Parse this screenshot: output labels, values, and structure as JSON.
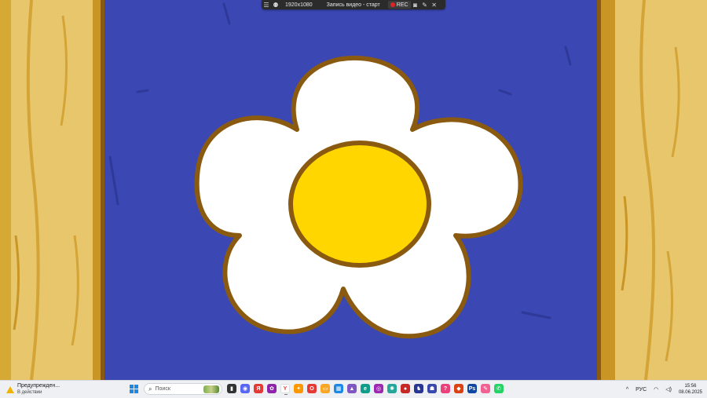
{
  "recorder": {
    "resolution": "1920x1080",
    "status": "Запись видео - старт",
    "rec_label": "REC",
    "icons": [
      "menu-icon",
      "user-icon",
      "camera-icon",
      "pen-icon",
      "close-icon"
    ]
  },
  "taskbar": {
    "notification_title": "Предупрежден...",
    "notification_sub": "В действии",
    "search_placeholder": "Поиск",
    "apps": [
      {
        "name": "task-view",
        "color": "#333333",
        "glyph": "▮"
      },
      {
        "name": "chat",
        "color": "#5865f2",
        "glyph": "◉"
      },
      {
        "name": "yandex",
        "color": "#e53935",
        "glyph": "Я"
      },
      {
        "name": "app-colorful",
        "color": "#8e24aa",
        "glyph": "✿"
      },
      {
        "name": "yandex-browser",
        "color": "#ffffff",
        "glyph": "Y"
      },
      {
        "name": "app-star",
        "color": "#ff9800",
        "glyph": "✦"
      },
      {
        "name": "opera",
        "color": "#e53935",
        "glyph": "O"
      },
      {
        "name": "files",
        "color": "#f9a825",
        "glyph": "▭"
      },
      {
        "name": "store",
        "color": "#1e88e5",
        "glyph": "▦"
      },
      {
        "name": "app-purple",
        "color": "#7e57c2",
        "glyph": "▲"
      },
      {
        "name": "edge",
        "color": "#0f9d8a",
        "glyph": "e"
      },
      {
        "name": "app-violet",
        "color": "#9c27b0",
        "glyph": "◎"
      },
      {
        "name": "app-teal",
        "color": "#26a69a",
        "glyph": "✺"
      },
      {
        "name": "app-red",
        "color": "#c62828",
        "glyph": "●"
      },
      {
        "name": "game-1",
        "color": "#283593",
        "glyph": "♞"
      },
      {
        "name": "game-2",
        "color": "#3949ab",
        "glyph": "☗"
      },
      {
        "name": "app-pink",
        "color": "#ec407a",
        "glyph": "?"
      },
      {
        "name": "office",
        "color": "#d84315",
        "glyph": "◆"
      },
      {
        "name": "photoshop",
        "color": "#0d47a1",
        "glyph": "Ps"
      },
      {
        "name": "app-gradient",
        "color": "#f06292",
        "glyph": "✎"
      },
      {
        "name": "whatsapp",
        "color": "#25d366",
        "glyph": "✆"
      }
    ],
    "tray": {
      "language": "РУС",
      "time": "15:56",
      "date": "08.06.2025"
    }
  },
  "colors": {
    "sky": "#3b47b2",
    "wood": "#e8c66c",
    "petal": "#ffffff",
    "outline": "#8a5a10",
    "center": "#ffd600"
  }
}
